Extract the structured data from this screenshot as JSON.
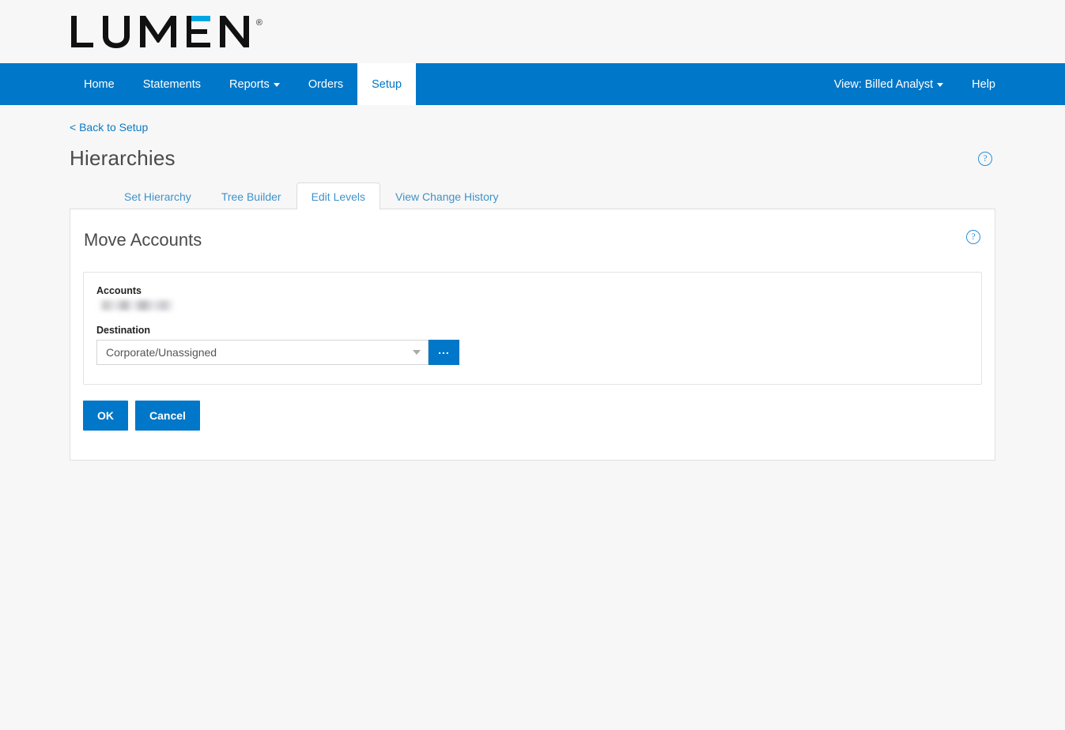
{
  "brand": {
    "logo_text": "LUMEN",
    "registered_mark": "®",
    "accent_color": "#00a6e2",
    "nav_color": "#0077c8"
  },
  "nav": {
    "left_items": [
      {
        "label": "Home",
        "active": false,
        "has_caret": false
      },
      {
        "label": "Statements",
        "active": false,
        "has_caret": false
      },
      {
        "label": "Reports",
        "active": false,
        "has_caret": true
      },
      {
        "label": "Orders",
        "active": false,
        "has_caret": false
      },
      {
        "label": "Setup",
        "active": true,
        "has_caret": false
      }
    ],
    "right_items": [
      {
        "label": "View: Billed Analyst",
        "has_caret": true
      },
      {
        "label": "Help",
        "has_caret": false
      }
    ]
  },
  "page": {
    "back_link": "< Back to Setup",
    "title": "Hierarchies",
    "help_icon": "question-circle-icon"
  },
  "tabs": [
    {
      "label": "Set Hierarchy",
      "active": false
    },
    {
      "label": "Tree Builder",
      "active": false
    },
    {
      "label": "Edit Levels",
      "active": true
    },
    {
      "label": "View Change History",
      "active": false
    }
  ],
  "panel": {
    "title": "Move Accounts",
    "help_icon": "question-circle-icon",
    "accounts": {
      "label": "Accounts",
      "value": "",
      "redacted": true
    },
    "destination": {
      "label": "Destination",
      "selected": "Corporate/Unassigned",
      "caret_icon": "chevron-down-icon",
      "browse_button_label": "..."
    },
    "buttons": {
      "ok": "OK",
      "cancel": "Cancel"
    }
  }
}
